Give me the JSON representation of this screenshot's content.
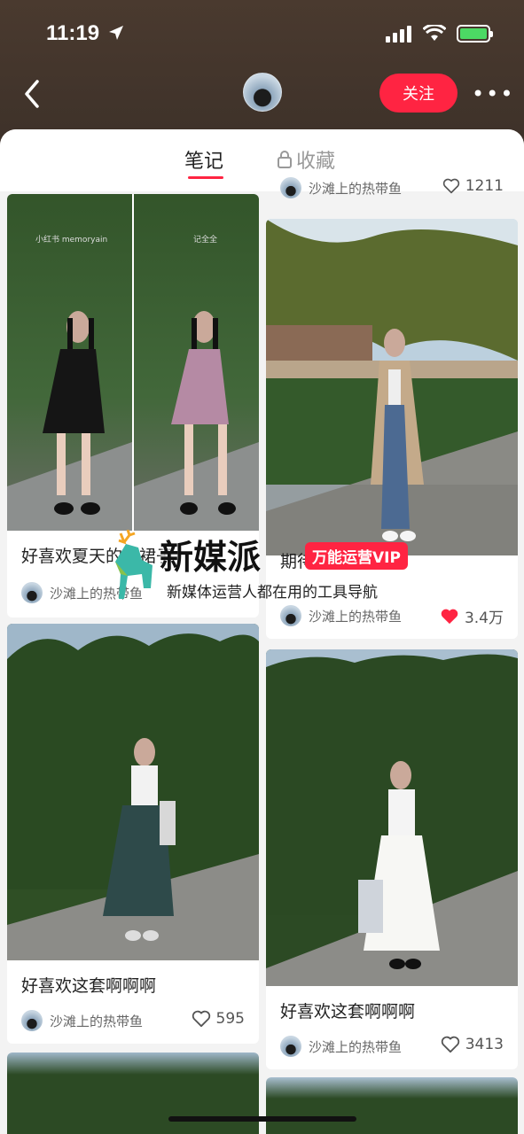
{
  "status": {
    "time": "11:19"
  },
  "header": {
    "follow_label": "关注",
    "more_label": "•••"
  },
  "tabs": {
    "notes": "笔记",
    "collect": "收藏"
  },
  "colors": {
    "accent": "#ff2442",
    "liked_heart": "#ff2442"
  },
  "cards": [
    {
      "id": "top-right",
      "title": "",
      "author": "沙滩上的热带鱼",
      "likes": "1211",
      "liked": false
    },
    {
      "id": "left-1",
      "title": "好喜欢夏天的小裙子",
      "author": "沙滩上的热带鱼",
      "likes": "",
      "liked": false,
      "photo_text_1": "小红书 memoryain",
      "photo_text_2": "记全全"
    },
    {
      "id": "right-1",
      "title": "期待一下秋冬！",
      "author": "沙滩上的热带鱼",
      "likes": "3.4万",
      "liked": true
    },
    {
      "id": "left-2",
      "title": "好喜欢这套啊啊啊",
      "author": "沙滩上的热带鱼",
      "likes": "595",
      "liked": false
    },
    {
      "id": "right-2",
      "title": "好喜欢这套啊啊啊",
      "author": "沙滩上的热带鱼",
      "likes": "3413",
      "liked": false
    }
  ],
  "watermark": {
    "title": "新媒派",
    "badge": "万能运营VIP",
    "subtitle": "新媒体运营人都在用的工具导航"
  },
  "icons": [
    "location-arrow-icon",
    "signal-icon",
    "wifi-icon",
    "battery-icon",
    "back-chevron-icon",
    "lock-icon",
    "heart-icon",
    "deer-logo-icon"
  ]
}
